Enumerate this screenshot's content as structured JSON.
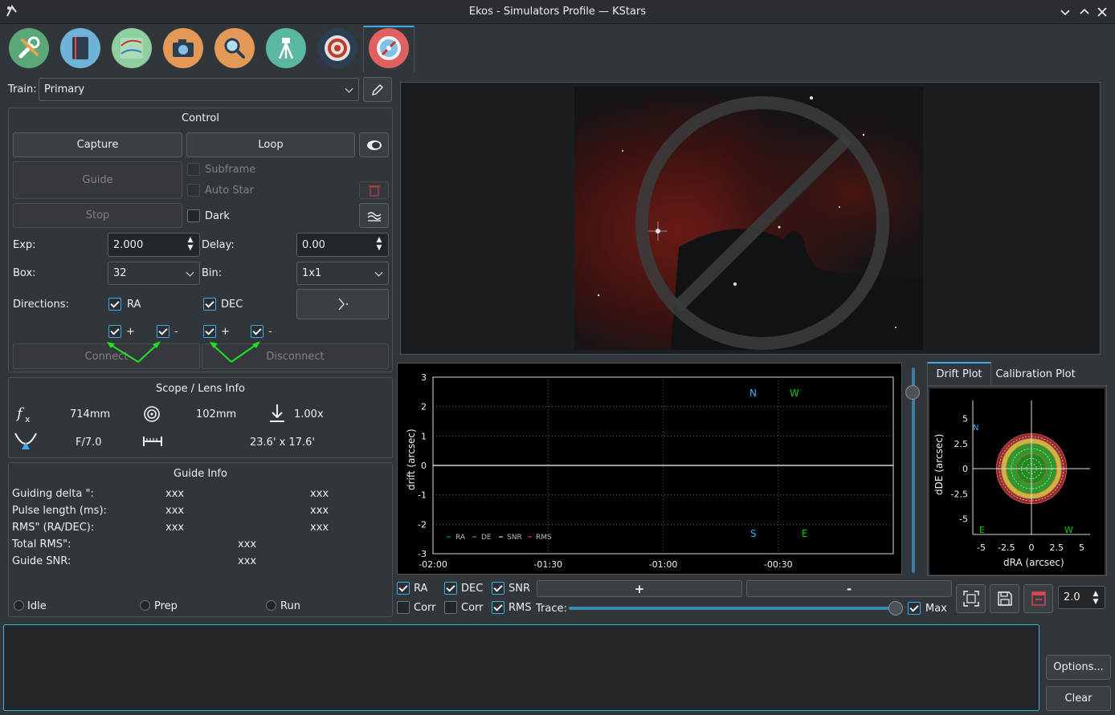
{
  "window": {
    "title": "Ekos - Simulators Profile — KStars"
  },
  "train": {
    "label": "Train:",
    "value": "Primary"
  },
  "control": {
    "title": "Control",
    "capture": "Capture",
    "loop": "Loop",
    "guide": "Guide",
    "stop": "Stop",
    "subframe": "Subframe",
    "auto_star": "Auto Star",
    "dark": "Dark",
    "exp_label": "Exp:",
    "exp_value": "2.000",
    "delay_label": "Delay:",
    "delay_value": "0.00",
    "box_label": "Box:",
    "box_value": "32",
    "bin_label": "Bin:",
    "bin_value": "1x1",
    "directions_label": "Directions:",
    "ra": "RA",
    "dec": "DEC",
    "plus": "+",
    "minus": "-",
    "connect": "Connect",
    "disconnect": "Disconnect"
  },
  "scope": {
    "title": "Scope / Lens Info",
    "focal": "714mm",
    "aperture": "102mm",
    "reducer": "1.00x",
    "fratio": "F/7.0",
    "fov": "23.6' x 17.6'"
  },
  "guide_info": {
    "title": "Guide Info",
    "rows": [
      {
        "label": "Guiding delta \":",
        "a": "xxx",
        "b": "xxx"
      },
      {
        "label": "Pulse length (ms):",
        "a": "xxx",
        "b": "xxx"
      },
      {
        "label": "RMS\" (RA/DEC):",
        "a": "xxx",
        "b": "xxx"
      }
    ],
    "total_rms_label": "Total RMS\":",
    "total_rms": "xxx",
    "snr_label": "Guide SNR:",
    "snr": "xxx",
    "states": [
      "Idle",
      "Prep",
      "Run"
    ]
  },
  "drift_graph": {
    "ylabel": "drift (arcsec)",
    "legend": [
      "RA",
      "DE",
      "SNR",
      "RMS"
    ],
    "compass": {
      "n": "N",
      "w": "W",
      "s": "S",
      "e": "E"
    },
    "controls": {
      "ra": "RA",
      "dec": "DEC",
      "snr": "SNR",
      "corr1": "Corr",
      "corr2": "Corr",
      "rms": "RMS",
      "plus": "+",
      "minus": "-",
      "trace": "Trace:",
      "max": "Max",
      "zoom": "2.0"
    }
  },
  "drift_plot": {
    "tab_drift": "Drift Plot",
    "tab_calibration": "Calibration Plot",
    "xlabel": "dRA (arcsec)",
    "ylabel": "dDE (arcsec)",
    "compass": {
      "n": "N",
      "e": "E",
      "w": "W"
    }
  },
  "log": {
    "options": "Options...",
    "clear": "Clear"
  },
  "colors": {
    "accent": "#3daee9",
    "ra": "#00d000",
    "de": "#3daee9"
  },
  "chart_data": [
    {
      "type": "line",
      "x_ticks": [
        "-02:00",
        "-01:30",
        "-01:00",
        "-00:30"
      ],
      "y_ticks": [
        3,
        2,
        1,
        0,
        -1,
        -2,
        -3
      ],
      "ylim": [
        -3,
        3
      ],
      "ylabel": "drift (arcsec)",
      "legend_placement": "bottom-left",
      "grid": true,
      "series": [
        {
          "name": "RA",
          "values": []
        },
        {
          "name": "DE",
          "values": []
        },
        {
          "name": "SNR",
          "values": []
        },
        {
          "name": "RMS",
          "values": []
        }
      ]
    },
    {
      "type": "scatter",
      "x_ticks": [
        "-5",
        "-2.5",
        "0",
        "2.5",
        "5"
      ],
      "y_ticks": [
        "5",
        "2.5",
        "0",
        "-2.5",
        "-5"
      ],
      "xlabel": "dRA (arcsec)",
      "ylabel": "dDE (arcsec)",
      "xlim": [
        -6,
        6
      ],
      "ylim": [
        -6,
        6
      ],
      "points": []
    }
  ]
}
